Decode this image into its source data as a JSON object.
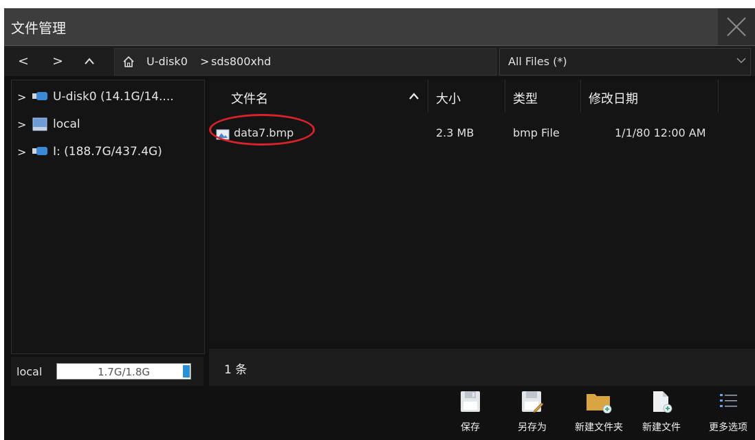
{
  "window": {
    "title": "文件管理"
  },
  "nav": {
    "back": "<",
    "forward": ">",
    "up": "^",
    "path": [
      {
        "label": "U-disk0"
      },
      {
        "label": ">"
      },
      {
        "label": "sds800xhd"
      }
    ],
    "filter": {
      "value": "All Files (*)"
    }
  },
  "tree": [
    {
      "label": "U-disk0  (14.1G/14....",
      "icon": "usb-drive-icon"
    },
    {
      "label": "local",
      "icon": "local-disk-icon"
    },
    {
      "label": "I:  (188.7G/437.4G)",
      "icon": "usb-drive-icon"
    }
  ],
  "columns": {
    "name": "文件名",
    "size": "大小",
    "type": "类型",
    "modified": "修改日期",
    "sort_indicator": "^"
  },
  "files": [
    {
      "name": "data7.bmp",
      "size": "2.3 MB",
      "type": "bmp File",
      "modified": "1/1/80 12:00 AM",
      "icon": "image-file-icon"
    }
  ],
  "status": {
    "disk_label": "local",
    "disk_usage": "1.7G/1.8G",
    "disk_fraction": 0.94,
    "item_count": "1 条"
  },
  "toolbar": [
    {
      "label": "保存",
      "icon": "save-icon"
    },
    {
      "label": "另存为",
      "icon": "save-as-icon"
    },
    {
      "label": "新建文件夹",
      "icon": "new-folder-icon"
    },
    {
      "label": "新建文件",
      "icon": "new-file-icon"
    },
    {
      "label": "更多选项",
      "icon": "more-options-icon"
    }
  ],
  "colors": {
    "annotation": "#d8232a",
    "usage_bar": "#2b8fd6",
    "folder": "#d9a441"
  }
}
